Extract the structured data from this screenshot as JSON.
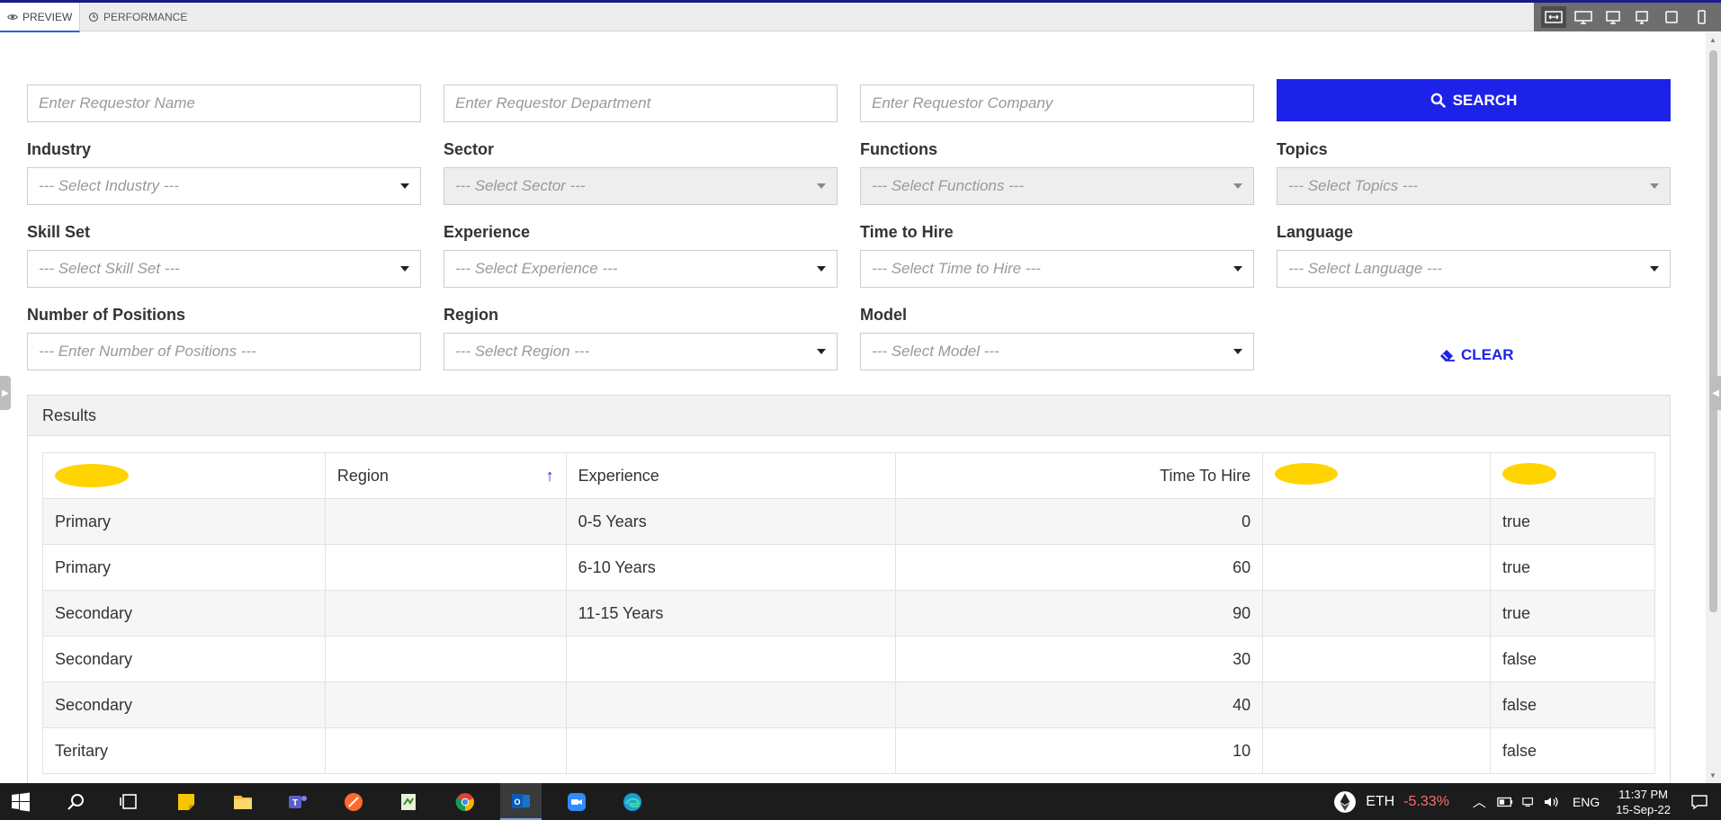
{
  "tabs": [
    {
      "label": "PREVIEW",
      "icon": "eye-icon",
      "active": true
    },
    {
      "label": "PERFORMANCE",
      "icon": "clock-icon",
      "active": false
    }
  ],
  "device_bar": [
    "fit-width-icon",
    "desktop-large-icon",
    "desktop-icon",
    "tablet-landscape-icon",
    "tablet-icon",
    "mobile-icon"
  ],
  "filters": {
    "requestor_name_placeholder": "Enter Requestor Name",
    "requestor_department_placeholder": "Enter Requestor Department",
    "requestor_company_placeholder": "Enter Requestor Company",
    "search_label": "SEARCH",
    "industry": {
      "label": "Industry",
      "value": "--- Select Industry ---"
    },
    "sector": {
      "label": "Sector",
      "value": "--- Select Sector ---"
    },
    "functions": {
      "label": "Functions",
      "value": "--- Select Functions ---"
    },
    "topics": {
      "label": "Topics",
      "value": "--- Select Topics ---"
    },
    "skill_set": {
      "label": "Skill Set",
      "value": "--- Select Skill Set ---"
    },
    "experience": {
      "label": "Experience",
      "value": "--- Select Experience ---"
    },
    "time_to_hire": {
      "label": "Time to Hire",
      "value": "--- Select Time to Hire ---"
    },
    "language": {
      "label": "Language",
      "value": "--- Select Language ---"
    },
    "number_of_positions": {
      "label": "Number of Positions",
      "value": "--- Enter Number of Positions ---"
    },
    "region": {
      "label": "Region",
      "value": "--- Select Region ---"
    },
    "model": {
      "label": "Model",
      "value": "--- Select Model ---"
    },
    "clear_label": "CLEAR"
  },
  "results": {
    "title": "Results",
    "columns": [
      "",
      "Region",
      "Experience",
      "Time To Hire",
      "",
      ""
    ],
    "rows": [
      [
        "Primary",
        "",
        "0-5 Years",
        "0",
        "",
        "true"
      ],
      [
        "Primary",
        "",
        "6-10 Years",
        "60",
        "",
        "true"
      ],
      [
        "Secondary",
        "",
        "11-15 Years",
        "90",
        "",
        "true"
      ],
      [
        "Secondary",
        "",
        "",
        "30",
        "",
        "false"
      ],
      [
        "Secondary",
        "",
        "",
        "40",
        "",
        "false"
      ],
      [
        "Teritary",
        "",
        "",
        "10",
        "",
        "false"
      ]
    ]
  },
  "taskbar": {
    "apps": [
      "windows-start-icon",
      "search-icon",
      "task-view-icon",
      "sticky-notes-icon",
      "file-explorer-icon",
      "teams-icon",
      "paint-icon",
      "notepad-icon",
      "chrome-icon",
      "outlook-icon",
      "zoom-icon",
      "edge-icon"
    ],
    "crypto_label": "ETH",
    "crypto_change": "-5.33%",
    "language": "ENG",
    "time": "11:37 PM",
    "date": "15-Sep-22"
  },
  "colors": {
    "accent": "#1d22e8",
    "redaction": "#ffd400",
    "negative": "#ff6b6b"
  }
}
